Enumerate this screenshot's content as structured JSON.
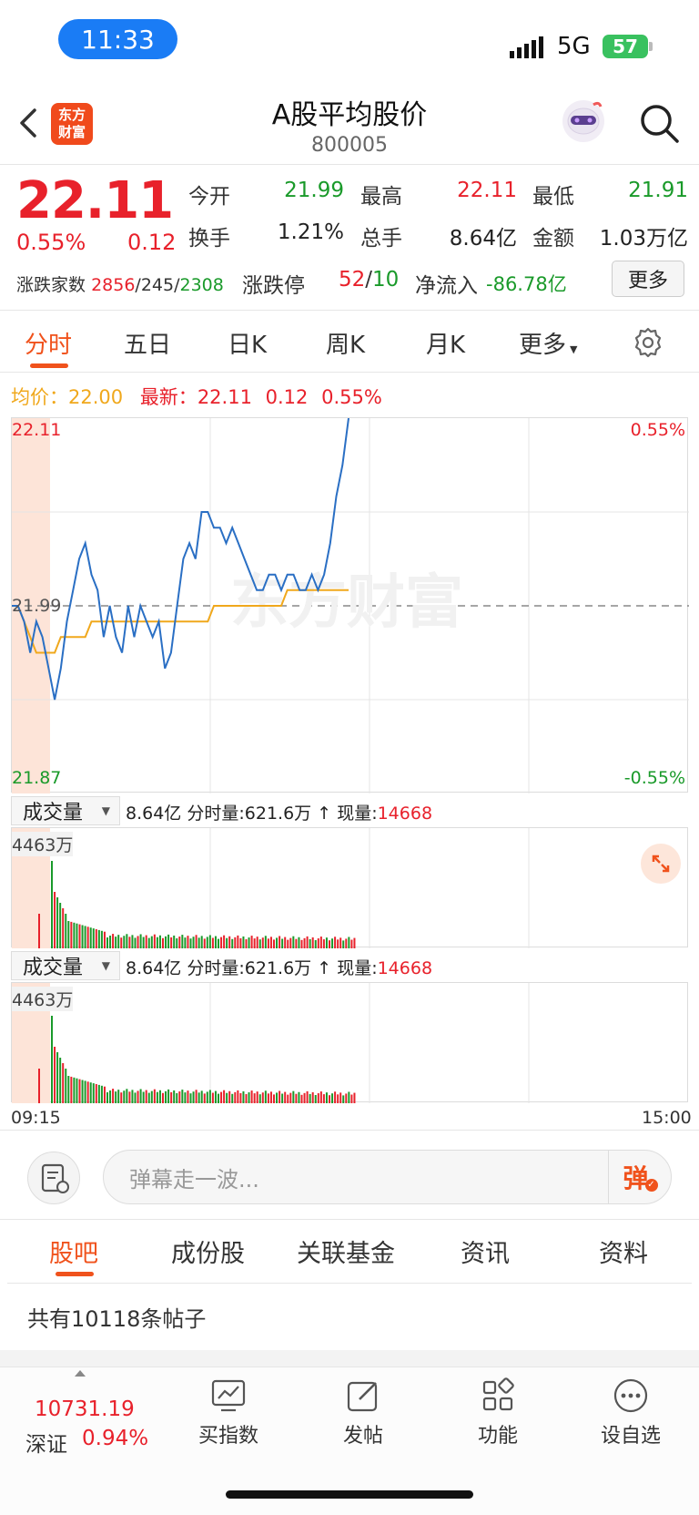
{
  "status": {
    "time": "11:33",
    "network": "5G",
    "battery": "57"
  },
  "header": {
    "logo": "东方财富",
    "title": "A股平均股价",
    "code": "800005"
  },
  "quote": {
    "price": "22.11",
    "change_pct": "0.55%",
    "change_amt": "0.12",
    "open_label": "今开",
    "open": "21.99",
    "high_label": "最高",
    "high": "22.11",
    "low_label": "最低",
    "low": "21.91",
    "turnover_label": "换手",
    "turnover": "1.21%",
    "volume_label": "总手",
    "volume": "8.64亿",
    "amount_label": "金额",
    "amount": "1.03万亿",
    "breadth_label": "涨跌家数",
    "up": "2856",
    "flat": "245",
    "down": "2308",
    "limit_label": "涨跌停",
    "limit_up": "52",
    "limit_down": "10",
    "inflow_label": "净流入",
    "inflow": "-86.78亿",
    "more": "更多"
  },
  "tabs": [
    {
      "label": "分时"
    },
    {
      "label": "五日"
    },
    {
      "label": "日K"
    },
    {
      "label": "周K"
    },
    {
      "label": "月K"
    },
    {
      "label": "更多"
    }
  ],
  "avgline": {
    "avg_label": "均价：",
    "avg": "22.00",
    "last_label": "最新：",
    "last": "22.11",
    "chg": "0.12",
    "pct": "0.55%"
  },
  "chart_data": {
    "type": "line",
    "y_top": "22.11",
    "y_mid": "21.99",
    "y_bottom": "21.87",
    "pct_top": "0.55%",
    "pct_bottom": "-0.55%",
    "ylim": [
      21.87,
      22.11
    ],
    "x_start": "09:15",
    "x_end": "15:00",
    "watermark": "东方财富",
    "series": [
      {
        "values": [
          21.99,
          21.99,
          21.98,
          21.96,
          21.98,
          21.97,
          21.95,
          21.93,
          21.95,
          21.98,
          22.0,
          22.02,
          22.03,
          22.01,
          22.0,
          21.97,
          21.99,
          21.97,
          21.96,
          21.99,
          21.97,
          21.99,
          21.98,
          21.97,
          21.98,
          21.95,
          21.96,
          21.99,
          22.02,
          22.03,
          22.02,
          22.05,
          22.05,
          22.04,
          22.04,
          22.03,
          22.04,
          22.03,
          22.02,
          22.01,
          22.0,
          22.0,
          22.01,
          22.01,
          22.0,
          22.01,
          22.01,
          22.0,
          22.0,
          22.01,
          22.0,
          22.01,
          22.03,
          22.06,
          22.08,
          22.11
        ]
      },
      {
        "values": [
          21.99,
          21.99,
          21.98,
          21.97,
          21.96,
          21.96,
          21.96,
          21.96,
          21.97,
          21.97,
          21.97,
          21.97,
          21.97,
          21.98,
          21.98,
          21.98,
          21.98,
          21.98,
          21.98,
          21.98,
          21.98,
          21.98,
          21.98,
          21.98,
          21.98,
          21.98,
          21.98,
          21.98,
          21.98,
          21.98,
          21.98,
          21.98,
          21.98,
          21.99,
          21.99,
          21.99,
          21.99,
          21.99,
          21.99,
          21.99,
          21.99,
          21.99,
          21.99,
          21.99,
          21.99,
          22.0,
          22.0,
          22.0,
          22.0,
          22.0,
          22.0,
          22.0,
          22.0,
          22.0,
          22.0,
          22.0
        ]
      }
    ]
  },
  "volume": {
    "selector": "成交量",
    "total": "8.64亿",
    "interval_label": "分时量:",
    "interval": "621.6万",
    "now_label": "现量:",
    "now": "14668",
    "max": "4463万"
  },
  "danmaku": {
    "placeholder": "弹幕走一波...",
    "button": "弹"
  },
  "bottom_tabs": [
    {
      "label": "股吧"
    },
    {
      "label": "成份股"
    },
    {
      "label": "关联基金"
    },
    {
      "label": "资讯"
    },
    {
      "label": "资料"
    }
  ],
  "posts": {
    "text": "共有10118条帖子"
  },
  "nav": {
    "index_value": "10731.19",
    "index_name": "深证",
    "index_pct": "0.94%",
    "items": [
      {
        "label": "买指数"
      },
      {
        "label": "发帖"
      },
      {
        "label": "功能"
      },
      {
        "label": "设自选"
      }
    ]
  }
}
